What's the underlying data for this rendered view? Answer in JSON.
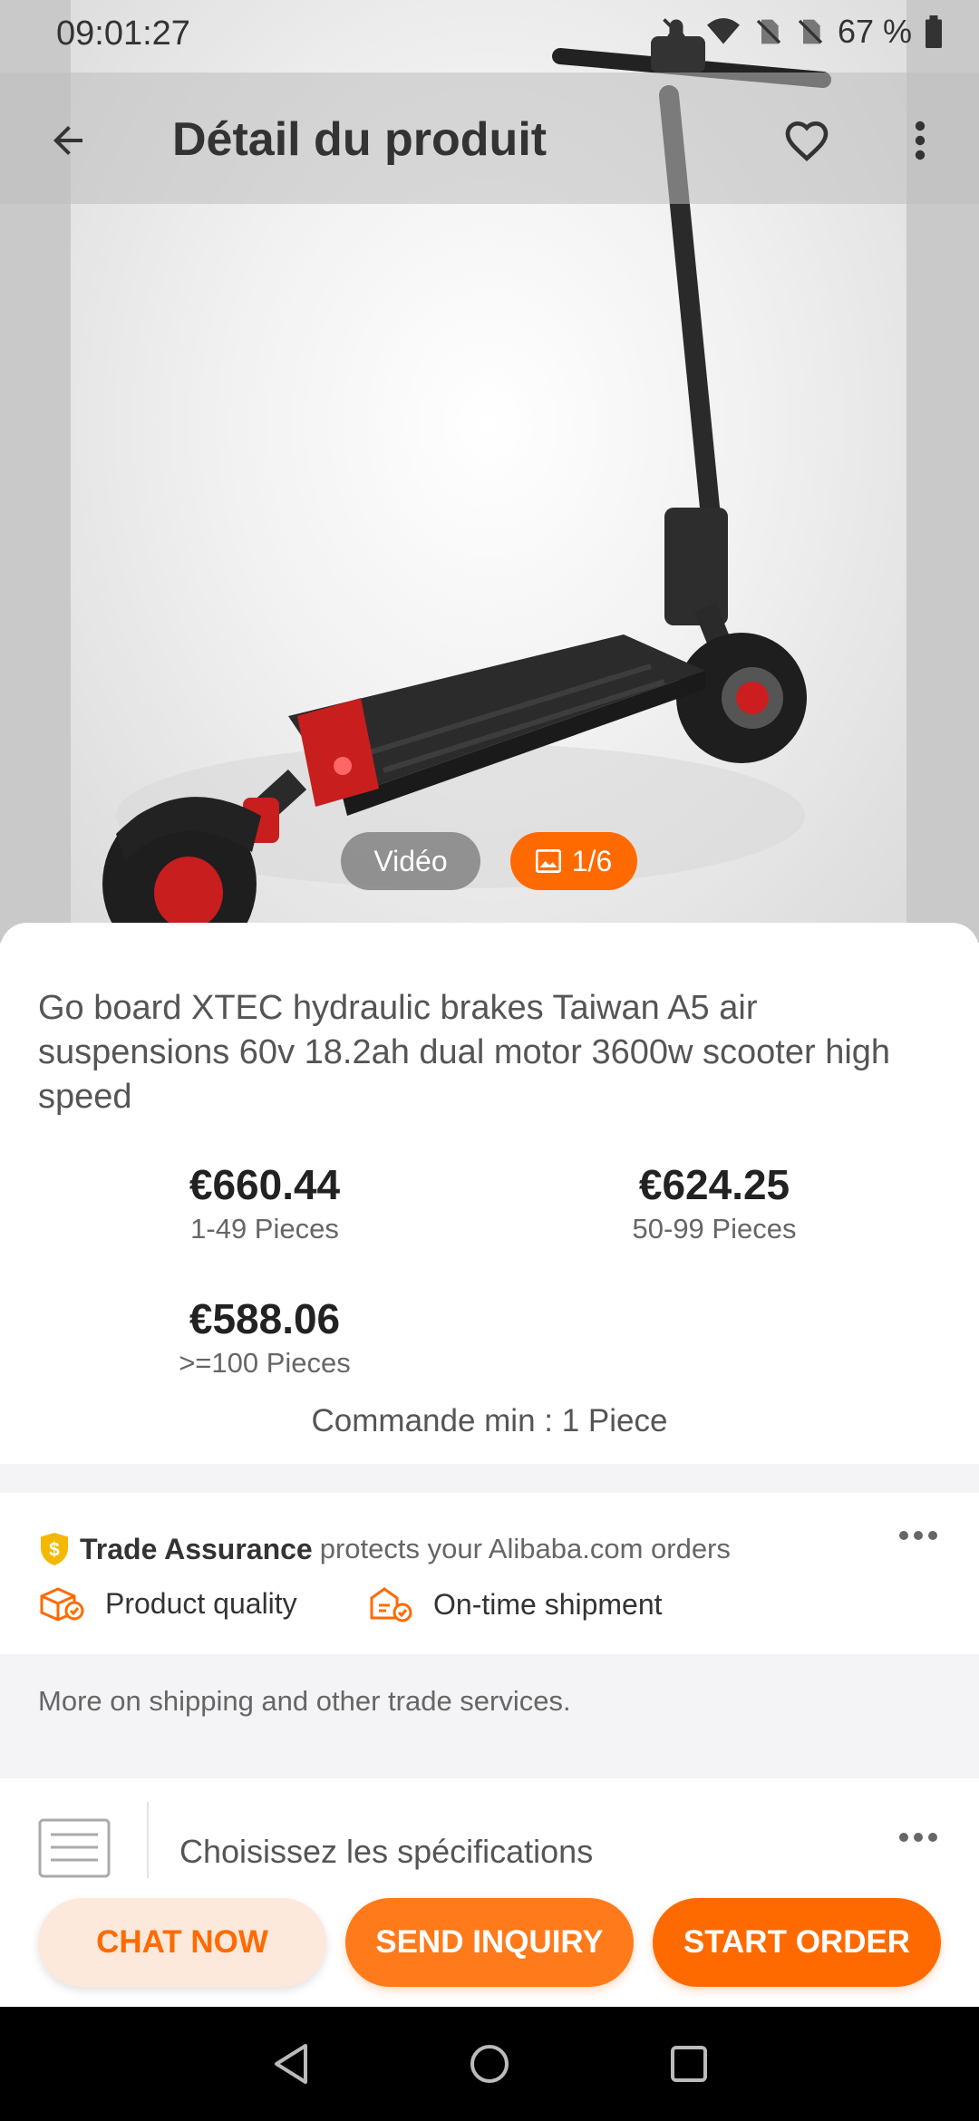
{
  "status_bar": {
    "time": "09:01:27",
    "battery": "67 %"
  },
  "toolbar": {
    "title": "Détail du produit"
  },
  "media": {
    "video_label": "Vidéo",
    "image_counter": "1/6"
  },
  "product": {
    "title": "Go board XTEC hydraulic brakes  Taiwan A5 air suspensions 60v 18.2ah dual motor 3600w scooter high speed",
    "prices": [
      {
        "value": "€660.44",
        "range": "1-49 Pieces"
      },
      {
        "value": "€624.25",
        "range": "50-99 Pieces"
      },
      {
        "value": "€588.06",
        "range": ">=100 Pieces"
      }
    ],
    "min_order": "Commande min : 1 Piece"
  },
  "trade_assurance": {
    "brand": "Trade Assurance",
    "text": "protects your Alibaba.com orders",
    "features": [
      "Product quality",
      "On-time shipment"
    ]
  },
  "shipping": {
    "text": "More on shipping and other trade services."
  },
  "specs": {
    "label": "Choisissez les spécifications"
  },
  "actions": {
    "chat": "CHAT NOW",
    "inquiry": "SEND INQUIRY",
    "order": "START ORDER"
  },
  "colors": {
    "accent": "#ff6a00",
    "chat_bg": "#fde9db"
  }
}
